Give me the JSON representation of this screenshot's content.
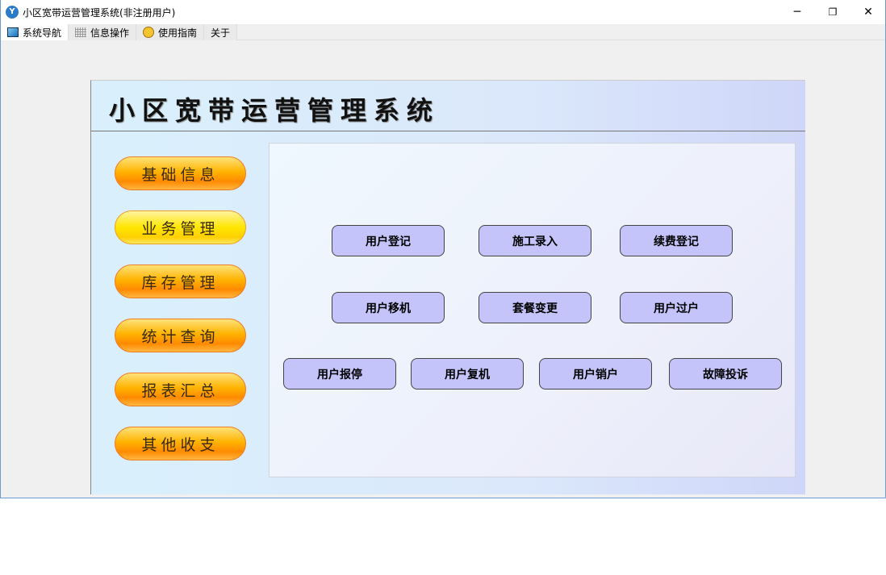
{
  "window": {
    "title": "小区宽带运营管理系统(非注册用户)",
    "minimize": "─",
    "restore": "❐",
    "close": "✕"
  },
  "tabs": [
    {
      "label": "系统导航"
    },
    {
      "label": "信息操作"
    },
    {
      "label": "使用指南"
    },
    {
      "label": "关于"
    }
  ],
  "header": {
    "title": "小区宽带运营管理系统"
  },
  "nav": [
    {
      "label": "基础信息"
    },
    {
      "label": "业务管理"
    },
    {
      "label": "库存管理"
    },
    {
      "label": "统计查询"
    },
    {
      "label": "报表汇总"
    },
    {
      "label": "其他收支"
    }
  ],
  "functions": [
    {
      "label": "用户登记"
    },
    {
      "label": "施工录入"
    },
    {
      "label": "续费登记"
    },
    {
      "label": "用户移机"
    },
    {
      "label": "套餐变更"
    },
    {
      "label": "用户过户"
    },
    {
      "label": "用户报停"
    },
    {
      "label": "用户复机"
    },
    {
      "label": "用户销户"
    },
    {
      "label": "故障投诉"
    }
  ]
}
